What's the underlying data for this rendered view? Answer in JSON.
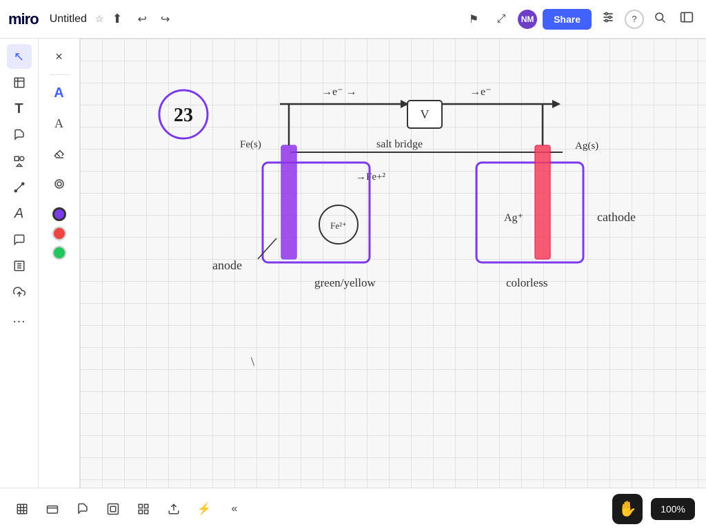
{
  "app": {
    "name": "miro",
    "title": "Untitled"
  },
  "topbar": {
    "doc_title": "Untitled",
    "star_label": "☆",
    "export_label": "⬆",
    "undo_label": "↩",
    "redo_label": "↪",
    "share_label": "Share",
    "flag_icon": "⚑",
    "cursor_icon": "⤢",
    "user_initials": "NM",
    "settings_icon": "⚙",
    "help_icon": "?",
    "search_icon": "🔍",
    "menu_icon": "☰"
  },
  "left_toolbar": {
    "tools": [
      {
        "name": "select",
        "icon": "↖",
        "label": "Select"
      },
      {
        "name": "frame",
        "icon": "⬜",
        "label": "Frame"
      },
      {
        "name": "text",
        "icon": "T",
        "label": "Text"
      },
      {
        "name": "sticky",
        "icon": "🗒",
        "label": "Sticky Note"
      },
      {
        "name": "shapes",
        "icon": "◻",
        "label": "Shapes"
      },
      {
        "name": "line",
        "icon": "╱",
        "label": "Line"
      },
      {
        "name": "text2",
        "icon": "A",
        "label": "Text 2"
      },
      {
        "name": "comment",
        "icon": "💬",
        "label": "Comment"
      },
      {
        "name": "align",
        "icon": "⊞",
        "label": "Align"
      },
      {
        "name": "upload",
        "icon": "⬆",
        "label": "Upload"
      },
      {
        "name": "more",
        "icon": "…",
        "label": "More"
      }
    ]
  },
  "pen_toolbar": {
    "close_label": "✕",
    "divider": true,
    "pen_icon": "A",
    "handwriting_icon": "A",
    "eraser_icon": "◻",
    "marker_icon": "◎",
    "colors": [
      {
        "name": "purple",
        "hex": "#7c3aed",
        "selected": true
      },
      {
        "name": "red",
        "hex": "#ef4444",
        "selected": false
      },
      {
        "name": "green",
        "hex": "#22c55e",
        "selected": false
      }
    ]
  },
  "bottom_toolbar": {
    "tools": [
      {
        "name": "table",
        "icon": "⊞"
      },
      {
        "name": "card",
        "icon": "▭"
      },
      {
        "name": "sticky-small",
        "icon": "□"
      },
      {
        "name": "frame-small",
        "icon": "◫"
      },
      {
        "name": "grid",
        "icon": "⊟"
      },
      {
        "name": "export-small",
        "icon": "⬡"
      },
      {
        "name": "lightning",
        "icon": "⚡"
      },
      {
        "name": "arrows",
        "icon": "«"
      }
    ]
  },
  "zoom": {
    "level": "100%"
  },
  "canvas": {
    "drawing_description": "Electrochemical cell diagram with anode and cathode"
  }
}
